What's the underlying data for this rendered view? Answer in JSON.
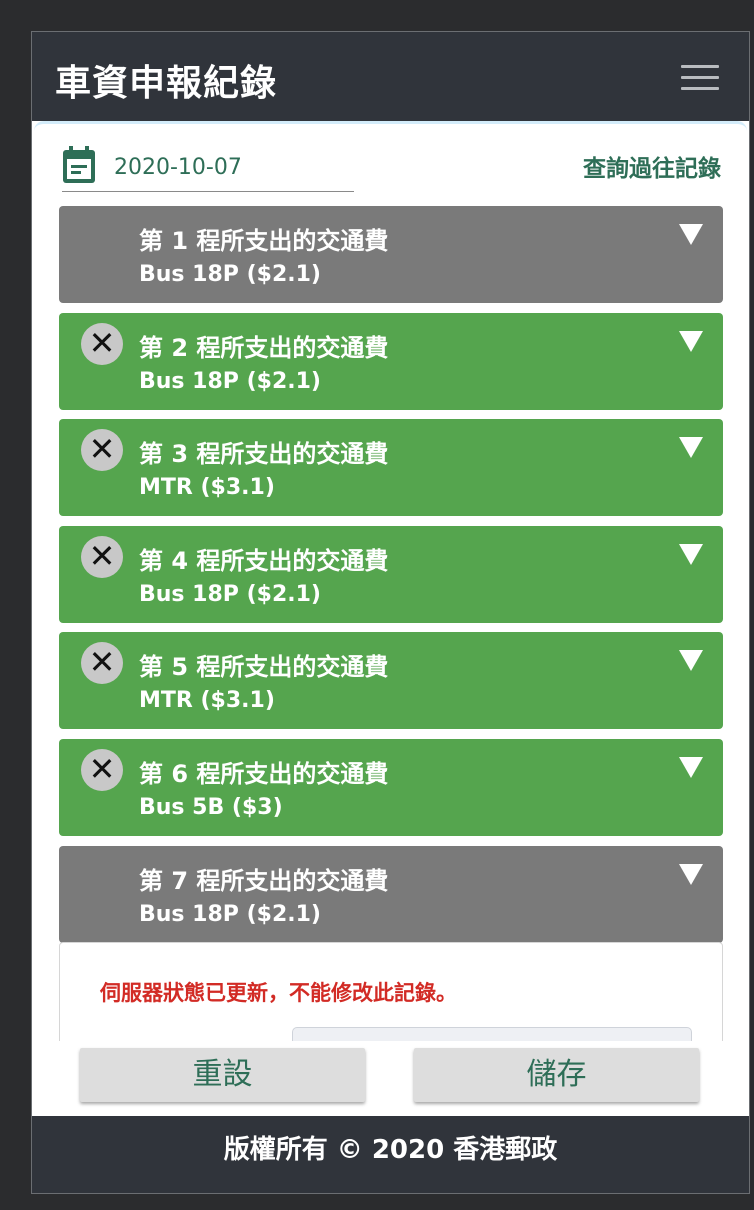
{
  "header": {
    "title": "車資申報紀錄",
    "menu_icon": "hamburger-menu-icon"
  },
  "date_picker": {
    "icon": "calendar-icon",
    "value": "2020-10-07"
  },
  "history_link": "查詢過往記錄",
  "trips": [
    {
      "title": "第 1 程所支出的交通費",
      "detail": "Bus 18P  ($2.1)",
      "status": "gray",
      "removable": false
    },
    {
      "title": "第 2 程所支出的交通費",
      "detail": "Bus 18P  ($2.1)",
      "status": "green",
      "removable": true
    },
    {
      "title": "第 3 程所支出的交通費",
      "detail": "MTR  ($3.1)",
      "status": "green",
      "removable": true
    },
    {
      "title": "第 4 程所支出的交通費",
      "detail": "Bus 18P  ($2.1)",
      "status": "green",
      "removable": true
    },
    {
      "title": "第 5 程所支出的交通費",
      "detail": "MTR  ($3.1)",
      "status": "green",
      "removable": true
    },
    {
      "title": "第 6 程所支出的交通費",
      "detail": "Bus 5B  ($3)",
      "status": "green",
      "removable": true
    },
    {
      "title": "第 7 程所支出的交通費",
      "detail": "Bus 18P  ($2.1)",
      "status": "gray",
      "removable": false
    }
  ],
  "remove_symbol": "✕",
  "detail_panel": {
    "error_message": "伺服器狀態已更新，不能修改此記錄。"
  },
  "buttons": {
    "reset": "重設",
    "save": "儲存"
  },
  "footer": "版權所有 © 2020 香港郵政",
  "colors": {
    "header_bg": "#30343b",
    "accent_green": "#55a54e",
    "trip_gray": "#7a7a7a",
    "text_green": "#2e6e57",
    "error_red": "#d22b25"
  }
}
